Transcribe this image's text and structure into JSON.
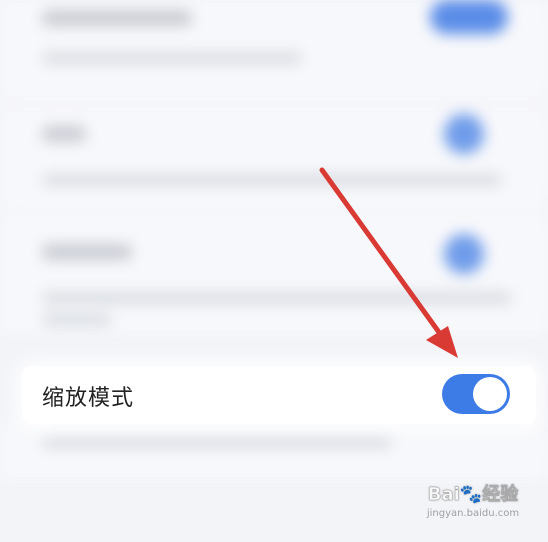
{
  "setting": {
    "label": "缩放模式",
    "enabled": true
  },
  "colors": {
    "toggle_on": "#3d7ce6",
    "arrow": "#d93a34",
    "background": "#f3f4f8"
  },
  "watermark": {
    "brand": "Bai🐾经验",
    "site": "jingyan.baidu.com"
  },
  "icons": {
    "annotation": "red-arrow-pointer",
    "toggle": "switch-on"
  }
}
